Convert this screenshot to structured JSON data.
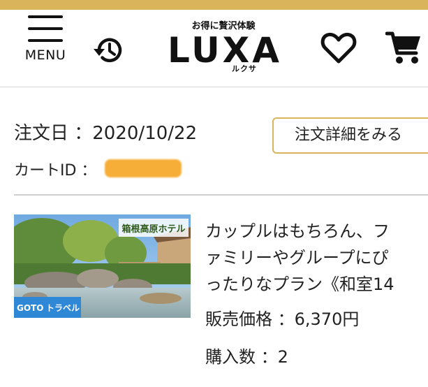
{
  "header": {
    "menu_label": "MENU",
    "logo_tagline": "お得に贅沢体験",
    "logo_text": "LUXA",
    "logo_kana": "ルクサ",
    "icons": [
      "menu-icon",
      "history-icon",
      "heart-icon",
      "cart-icon"
    ]
  },
  "order": {
    "date_text": "注文日 ：2020/10/22",
    "cart_id_label": "カートID ：",
    "detail_button_label": "注文詳細をみる"
  },
  "product": {
    "image_title": "箱根高原ホテル",
    "image_badge_goto": "GOTO",
    "image_badge_travel": "トラベル",
    "title_lines": [
      "カップルはもちろん、フ",
      "ァミリーやグループにぴ",
      "ったりなプラン《和室14"
    ],
    "price_text": "販売価格 ：6,370円",
    "quantity_text": "購入数 ：2"
  },
  "colors": {
    "accent_gold": "#d9b45a",
    "redaction": "#f6a623"
  }
}
